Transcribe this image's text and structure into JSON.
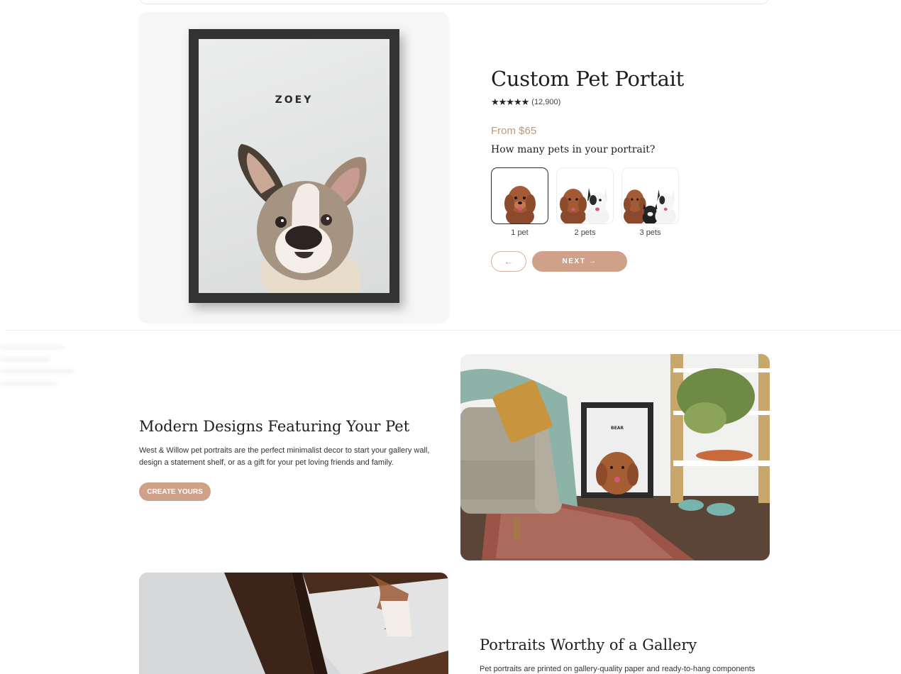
{
  "product": {
    "pet_name": "ZOEY",
    "title": "Custom Pet Portait",
    "stars": "★★★★★",
    "rating_count": "(12,900)",
    "price": "From $65",
    "question": "How many pets in your portrait?",
    "pet_options": [
      {
        "label": "1 pet",
        "selected": true
      },
      {
        "label": "2 pets",
        "selected": false
      },
      {
        "label": "3 pets",
        "selected": false
      }
    ],
    "prev_label": "←",
    "next_label": "NEXT →"
  },
  "section_modern": {
    "title": "Modern Designs Featuring Your Pet",
    "body": "West & Willow pet portraits are the perfect minimalist decor to start your gallery wall, design a statement shelf, or as a gift for your pet loving friends and family.",
    "cta_label": "CREATE YOURS",
    "frame_name": "BEAR"
  },
  "section_gallery": {
    "title": "Portraits Worthy of a Gallery",
    "body": "Pet portraits are printed on gallery-quality paper and ready-to-hang components"
  },
  "colors": {
    "accent": "#cfa189",
    "price": "#c4977a",
    "text": "#1d1f22"
  }
}
